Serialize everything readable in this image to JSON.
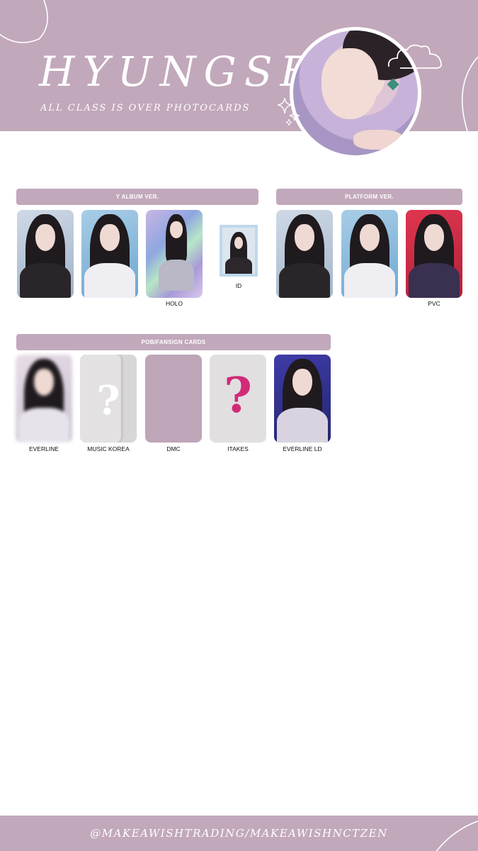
{
  "header": {
    "title": "HYUNGSEO",
    "subtitle": "ALL CLASS IS OVER PHOTOCARDS",
    "background": "#c2a8bb",
    "decorations": [
      "cloud-icon",
      "sparkle-icon"
    ]
  },
  "sections": {
    "y_album": {
      "title": "Y ALBUM VER.",
      "cards": [
        {
          "label": ""
        },
        {
          "label": ""
        },
        {
          "label": "HOLO"
        },
        {
          "label": "ID"
        }
      ]
    },
    "platform": {
      "title": "PLATFORM VER.",
      "cards": [
        {
          "label": ""
        },
        {
          "label": ""
        },
        {
          "label": "PVC"
        }
      ]
    },
    "pob": {
      "title": "POB/FANSIGN CARDS",
      "cards": [
        {
          "label": "EVERLINE"
        },
        {
          "label": "MUSIC KOREA",
          "placeholder": "?"
        },
        {
          "label": "DMC"
        },
        {
          "label": "ITAKES",
          "placeholder": "?"
        },
        {
          "label": "EVERLINE LD"
        }
      ]
    }
  },
  "colors": {
    "accent": "#c2a8bb",
    "question_mark_pink": "#d12a78",
    "placeholder_grey": "#e1dfe0"
  },
  "footer": {
    "text": "@MAKEAWISHTRADING/MAKEAWISHNCTZEN"
  }
}
